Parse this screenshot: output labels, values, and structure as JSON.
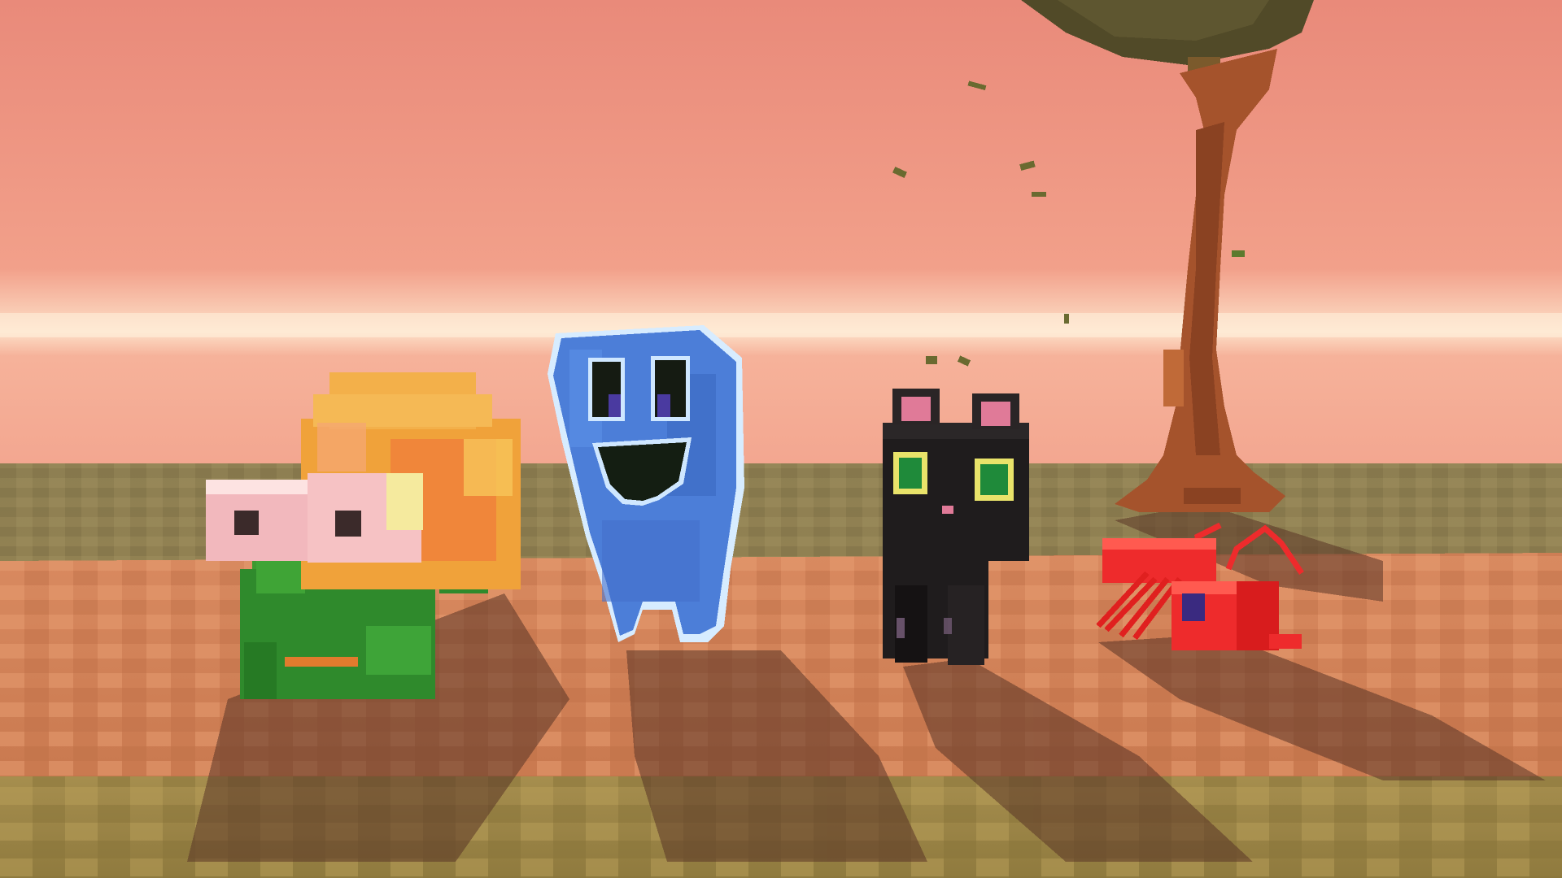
{
  "scene": {
    "palette": {
      "sky_top": "#e98c7c",
      "sky_mid": "#f3a58c",
      "horizon_glow": "#fff1d6",
      "ground_far": "#8a7a4a",
      "path": "#d9875c",
      "ground_near": "#a08a48",
      "shadow": "#5a3426"
    },
    "characters": [
      {
        "name": "snail",
        "shell_color": "#f0a23a",
        "body_color": "#2f8a2c",
        "eye_color": "#f2b8bd"
      },
      {
        "name": "blue-ghost",
        "body_color": "#4c7ed8",
        "mouth_color": "#141e12"
      },
      {
        "name": "black-cat",
        "body_color": "#1f1c1d",
        "eye_color": "#1f8a3a",
        "ear_color": "#e07a98"
      },
      {
        "name": "red-ant",
        "body_color": "#ee2b2c"
      }
    ],
    "tree": {
      "trunk_color": "#a5532c",
      "leaf_color": "#4f4a2a"
    }
  }
}
